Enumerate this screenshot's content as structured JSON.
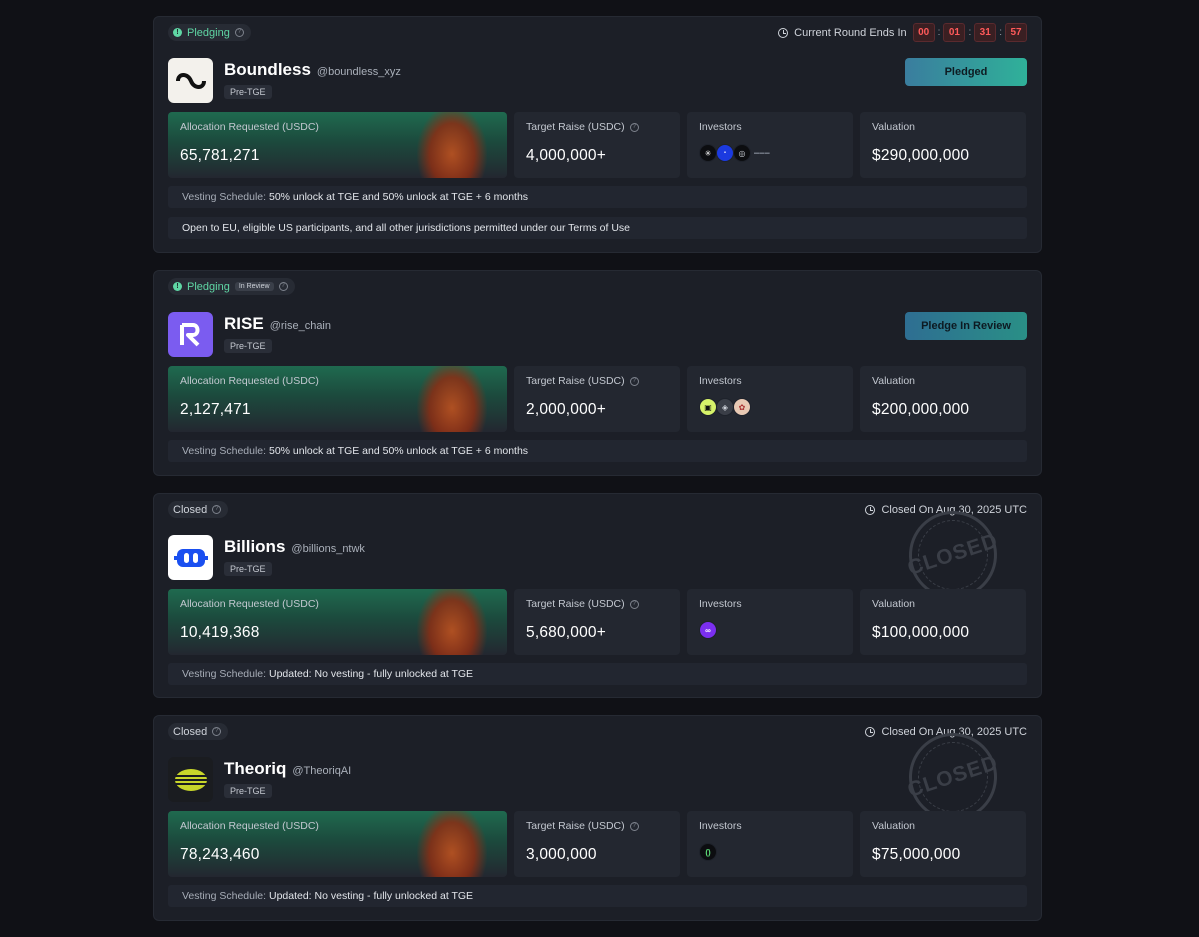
{
  "labels": {
    "allocation": "Allocation Requested (USDC)",
    "target": "Target Raise (USDC)",
    "investors": "Investors",
    "valuation": "Valuation",
    "vesting_key": "Vesting Schedule:",
    "pledging": "Pledging",
    "closed": "Closed",
    "in_review": "In Review",
    "round_ends": "Current Round Ends In"
  },
  "timer": {
    "h": "00",
    "m": "01",
    "s": "31",
    "ms": "57"
  },
  "projects": [
    {
      "status": "Pledging",
      "name": "Boundless",
      "handle": "@boundless_xyz",
      "tag": "Pre-TGE",
      "button": "Pledged",
      "allocation": "65,781,271",
      "target": "4,000,000+",
      "valuation": "$290,000,000",
      "vesting": "50% unlock at TGE and 50% unlock at TGE + 6 months",
      "note": "Open to EU, eligible US participants, and all other jurisdictions permitted under our Terms of Use"
    },
    {
      "status": "Pledging",
      "badge": "In Review",
      "name": "RISE",
      "handle": "@rise_chain",
      "tag": "Pre-TGE",
      "button": "Pledge In Review",
      "allocation": "2,127,471",
      "target": "2,000,000+",
      "valuation": "$200,000,000",
      "vesting": "50% unlock at TGE and 50% unlock at TGE + 6 months"
    },
    {
      "status": "Closed",
      "closed_on": "Closed On Aug 30, 2025 UTC",
      "stamp": "CLOSED",
      "name": "Billions",
      "handle": "@billions_ntwk",
      "tag": "Pre-TGE",
      "allocation": "10,419,368",
      "target": "5,680,000+",
      "valuation": "$100,000,000",
      "vesting": "Updated: No vesting - fully unlocked at TGE"
    },
    {
      "status": "Closed",
      "closed_on": "Closed On Aug 30, 2025 UTC",
      "stamp": "CLOSED",
      "name": "Theoriq",
      "handle": "@TheoriqAI",
      "tag": "Pre-TGE",
      "allocation": "78,243,460",
      "target": "3,000,000",
      "valuation": "$75,000,000",
      "vesting": "Updated: No vesting - fully unlocked at TGE"
    }
  ],
  "colors": {
    "accent": "#5fd6a4",
    "timer_red": "#ff5a5a",
    "card_bg": "#1c1f27"
  }
}
